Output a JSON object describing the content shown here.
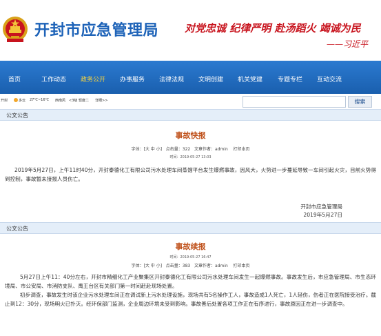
{
  "header": {
    "site_title": "开封市应急管理局",
    "slogan": "对党忠诚  纪律严明  赴汤蹈火  竭诚为民",
    "slogan_sign": "——习近平"
  },
  "nav": {
    "items": [
      {
        "label": "首页",
        "active": false
      },
      {
        "label": "工作动态",
        "active": false
      },
      {
        "label": "政务公开",
        "active": true
      },
      {
        "label": "办事服务",
        "active": false
      },
      {
        "label": "法律法规",
        "active": false
      },
      {
        "label": "文明创建",
        "active": false
      },
      {
        "label": "机关党建",
        "active": false
      },
      {
        "label": "专题专栏",
        "active": false
      },
      {
        "label": "互动交流",
        "active": false
      }
    ]
  },
  "weather": {
    "city": "开封",
    "condition": "多云",
    "temp": "27℃~16℃",
    "wind": "西南风",
    "wind_level": "<3级",
    "pollution": "轻度二",
    "detail_link": "详细>>"
  },
  "search": {
    "placeholder": "",
    "button_label": "搜索"
  },
  "section1": {
    "head": "公文公告",
    "title": "事故快报",
    "meta": {
      "font_prefix": "字体：",
      "font_sizes": "[大 中 小]",
      "hits_label": "点击量：",
      "hits": "322",
      "author_label": "文章作者：",
      "author": "admin",
      "print": "打印本页"
    },
    "time": "时间：2019-05-27 13:03",
    "paragraph": "2019年5月27日，上午11时40分，开封泰德化工有限公司污水处理车间蒸馏平台发生爆燃事故，因风大，火势进一步蔓延导致一车间引起火灾，目前火势得到控制，事故暂未接报人员伤亡。",
    "sign_org": "开封市应急管理局",
    "sign_date": "2019年5月27日"
  },
  "section2": {
    "head": "公文公告",
    "title": "事故续报",
    "meta": {
      "font_prefix": "字体：",
      "font_sizes": "[大 中 小]",
      "hits_label": "点击量：",
      "hits": "383",
      "author_label": "文章作者：",
      "author": "admin",
      "print": "打印本页"
    },
    "time": "时间：2019-05-27 16:47",
    "paragraph1": "5月27日上午11：40分左右，开封市精细化工产业聚集区开封泰德化工有限公司污水处理车间发生一起爆燃事故。事故发生后，市应急管理局、市生态环境局、市公安局、市消防支队、禹王台区有关部门第一时间赶赴现场处置。",
    "paragraph2": "初步调查，事故发生时该企业污水处理车间正在调试新上污水处理设施，现场共有5名操作工人，事故造成1人死亡，1人轻伤，伤者正在医院接受治疗。截止到12：30分，现场明火已扑灭。经环保部门监测，企业周边环境未受到影响。事故善后处置各项工作正在有序进行，事故原因正在进一步调查中。"
  },
  "colors": {
    "nav_bg": "#1f6bbf",
    "title_blue": "#1e63b8",
    "slogan_red": "#c8141e",
    "article_title": "#c0521c",
    "section_bg": "#e4eef9"
  }
}
